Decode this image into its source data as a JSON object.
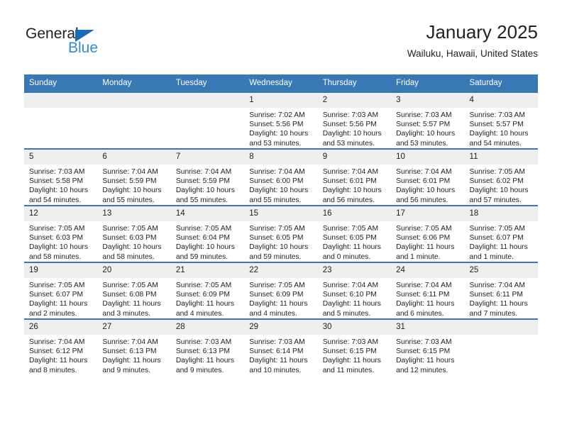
{
  "brand": {
    "word_one": "General",
    "word_two": "Blue",
    "logo_icon": "triangle-flag-icon"
  },
  "header": {
    "title": "January 2025",
    "subtitle": "Wailuku, Hawaii, United States"
  },
  "colors": {
    "header_blue": "#3878b4",
    "day_band_gray": "#efefef",
    "brand_blue": "#2e8bd8",
    "logo_blue": "#1b6cb5",
    "text": "#222222"
  },
  "weekday_headers": [
    "Sunday",
    "Monday",
    "Tuesday",
    "Wednesday",
    "Thursday",
    "Friday",
    "Saturday"
  ],
  "labels": {
    "sunrise_prefix": "Sunrise:",
    "sunset_prefix": "Sunset:",
    "daylight_prefix": "Daylight:"
  },
  "weeks": [
    [
      {
        "day": "",
        "empty": true
      },
      {
        "day": "",
        "empty": true
      },
      {
        "day": "",
        "empty": true
      },
      {
        "day": "1",
        "sunrise": "Sunrise: 7:02 AM",
        "sunset": "Sunset: 5:56 PM",
        "daylight_line1": "Daylight: 10 hours",
        "daylight_line2": "and 53 minutes."
      },
      {
        "day": "2",
        "sunrise": "Sunrise: 7:03 AM",
        "sunset": "Sunset: 5:56 PM",
        "daylight_line1": "Daylight: 10 hours",
        "daylight_line2": "and 53 minutes."
      },
      {
        "day": "3",
        "sunrise": "Sunrise: 7:03 AM",
        "sunset": "Sunset: 5:57 PM",
        "daylight_line1": "Daylight: 10 hours",
        "daylight_line2": "and 53 minutes."
      },
      {
        "day": "4",
        "sunrise": "Sunrise: 7:03 AM",
        "sunset": "Sunset: 5:57 PM",
        "daylight_line1": "Daylight: 10 hours",
        "daylight_line2": "and 54 minutes."
      }
    ],
    [
      {
        "day": "5",
        "sunrise": "Sunrise: 7:03 AM",
        "sunset": "Sunset: 5:58 PM",
        "daylight_line1": "Daylight: 10 hours",
        "daylight_line2": "and 54 minutes."
      },
      {
        "day": "6",
        "sunrise": "Sunrise: 7:04 AM",
        "sunset": "Sunset: 5:59 PM",
        "daylight_line1": "Daylight: 10 hours",
        "daylight_line2": "and 55 minutes."
      },
      {
        "day": "7",
        "sunrise": "Sunrise: 7:04 AM",
        "sunset": "Sunset: 5:59 PM",
        "daylight_line1": "Daylight: 10 hours",
        "daylight_line2": "and 55 minutes."
      },
      {
        "day": "8",
        "sunrise": "Sunrise: 7:04 AM",
        "sunset": "Sunset: 6:00 PM",
        "daylight_line1": "Daylight: 10 hours",
        "daylight_line2": "and 55 minutes."
      },
      {
        "day": "9",
        "sunrise": "Sunrise: 7:04 AM",
        "sunset": "Sunset: 6:01 PM",
        "daylight_line1": "Daylight: 10 hours",
        "daylight_line2": "and 56 minutes."
      },
      {
        "day": "10",
        "sunrise": "Sunrise: 7:04 AM",
        "sunset": "Sunset: 6:01 PM",
        "daylight_line1": "Daylight: 10 hours",
        "daylight_line2": "and 56 minutes."
      },
      {
        "day": "11",
        "sunrise": "Sunrise: 7:05 AM",
        "sunset": "Sunset: 6:02 PM",
        "daylight_line1": "Daylight: 10 hours",
        "daylight_line2": "and 57 minutes."
      }
    ],
    [
      {
        "day": "12",
        "sunrise": "Sunrise: 7:05 AM",
        "sunset": "Sunset: 6:03 PM",
        "daylight_line1": "Daylight: 10 hours",
        "daylight_line2": "and 58 minutes."
      },
      {
        "day": "13",
        "sunrise": "Sunrise: 7:05 AM",
        "sunset": "Sunset: 6:03 PM",
        "daylight_line1": "Daylight: 10 hours",
        "daylight_line2": "and 58 minutes."
      },
      {
        "day": "14",
        "sunrise": "Sunrise: 7:05 AM",
        "sunset": "Sunset: 6:04 PM",
        "daylight_line1": "Daylight: 10 hours",
        "daylight_line2": "and 59 minutes."
      },
      {
        "day": "15",
        "sunrise": "Sunrise: 7:05 AM",
        "sunset": "Sunset: 6:05 PM",
        "daylight_line1": "Daylight: 10 hours",
        "daylight_line2": "and 59 minutes."
      },
      {
        "day": "16",
        "sunrise": "Sunrise: 7:05 AM",
        "sunset": "Sunset: 6:05 PM",
        "daylight_line1": "Daylight: 11 hours",
        "daylight_line2": "and 0 minutes."
      },
      {
        "day": "17",
        "sunrise": "Sunrise: 7:05 AM",
        "sunset": "Sunset: 6:06 PM",
        "daylight_line1": "Daylight: 11 hours",
        "daylight_line2": "and 1 minute."
      },
      {
        "day": "18",
        "sunrise": "Sunrise: 7:05 AM",
        "sunset": "Sunset: 6:07 PM",
        "daylight_line1": "Daylight: 11 hours",
        "daylight_line2": "and 1 minute."
      }
    ],
    [
      {
        "day": "19",
        "sunrise": "Sunrise: 7:05 AM",
        "sunset": "Sunset: 6:07 PM",
        "daylight_line1": "Daylight: 11 hours",
        "daylight_line2": "and 2 minutes."
      },
      {
        "day": "20",
        "sunrise": "Sunrise: 7:05 AM",
        "sunset": "Sunset: 6:08 PM",
        "daylight_line1": "Daylight: 11 hours",
        "daylight_line2": "and 3 minutes."
      },
      {
        "day": "21",
        "sunrise": "Sunrise: 7:05 AM",
        "sunset": "Sunset: 6:09 PM",
        "daylight_line1": "Daylight: 11 hours",
        "daylight_line2": "and 4 minutes."
      },
      {
        "day": "22",
        "sunrise": "Sunrise: 7:05 AM",
        "sunset": "Sunset: 6:09 PM",
        "daylight_line1": "Daylight: 11 hours",
        "daylight_line2": "and 4 minutes."
      },
      {
        "day": "23",
        "sunrise": "Sunrise: 7:04 AM",
        "sunset": "Sunset: 6:10 PM",
        "daylight_line1": "Daylight: 11 hours",
        "daylight_line2": "and 5 minutes."
      },
      {
        "day": "24",
        "sunrise": "Sunrise: 7:04 AM",
        "sunset": "Sunset: 6:11 PM",
        "daylight_line1": "Daylight: 11 hours",
        "daylight_line2": "and 6 minutes."
      },
      {
        "day": "25",
        "sunrise": "Sunrise: 7:04 AM",
        "sunset": "Sunset: 6:11 PM",
        "daylight_line1": "Daylight: 11 hours",
        "daylight_line2": "and 7 minutes."
      }
    ],
    [
      {
        "day": "26",
        "sunrise": "Sunrise: 7:04 AM",
        "sunset": "Sunset: 6:12 PM",
        "daylight_line1": "Daylight: 11 hours",
        "daylight_line2": "and 8 minutes."
      },
      {
        "day": "27",
        "sunrise": "Sunrise: 7:04 AM",
        "sunset": "Sunset: 6:13 PM",
        "daylight_line1": "Daylight: 11 hours",
        "daylight_line2": "and 9 minutes."
      },
      {
        "day": "28",
        "sunrise": "Sunrise: 7:03 AM",
        "sunset": "Sunset: 6:13 PM",
        "daylight_line1": "Daylight: 11 hours",
        "daylight_line2": "and 9 minutes."
      },
      {
        "day": "29",
        "sunrise": "Sunrise: 7:03 AM",
        "sunset": "Sunset: 6:14 PM",
        "daylight_line1": "Daylight: 11 hours",
        "daylight_line2": "and 10 minutes."
      },
      {
        "day": "30",
        "sunrise": "Sunrise: 7:03 AM",
        "sunset": "Sunset: 6:15 PM",
        "daylight_line1": "Daylight: 11 hours",
        "daylight_line2": "and 11 minutes."
      },
      {
        "day": "31",
        "sunrise": "Sunrise: 7:03 AM",
        "sunset": "Sunset: 6:15 PM",
        "daylight_line1": "Daylight: 11 hours",
        "daylight_line2": "and 12 minutes."
      },
      {
        "day": "",
        "empty": true
      }
    ]
  ]
}
